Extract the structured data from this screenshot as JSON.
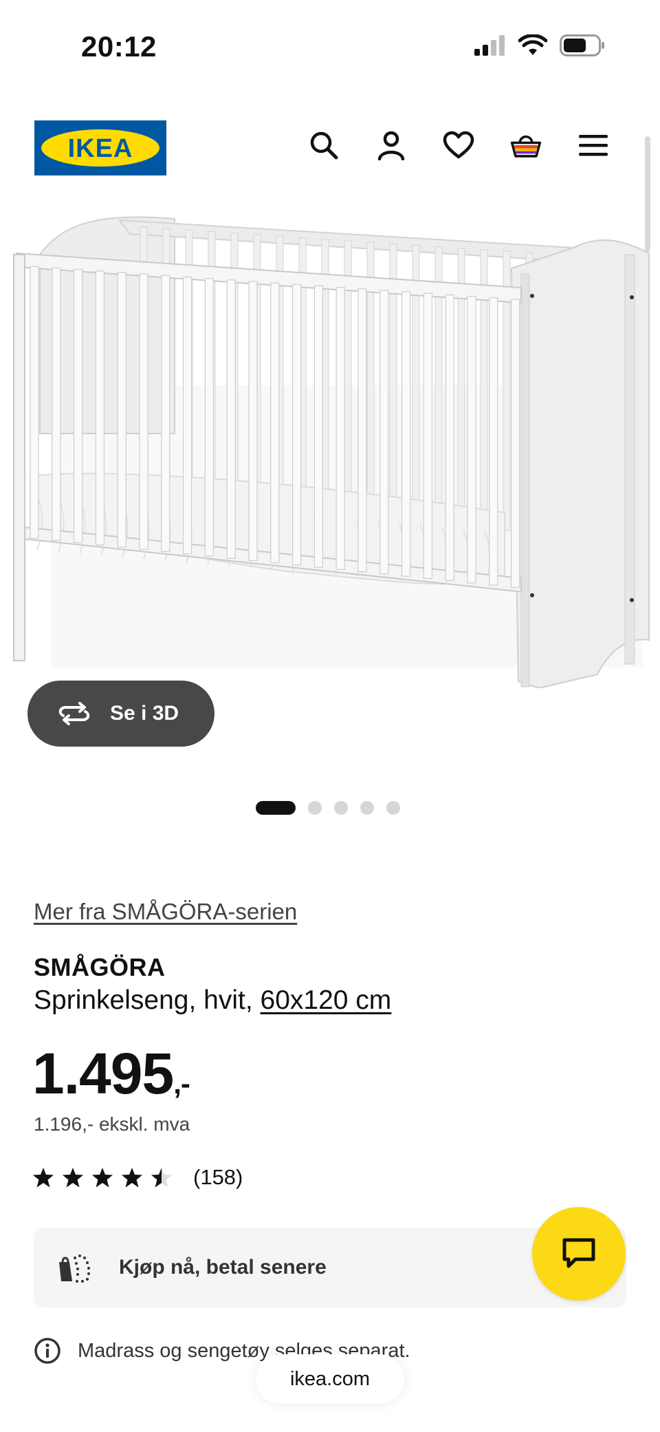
{
  "status_bar": {
    "time": "20:12",
    "icons": [
      "signal-icon",
      "wifi-icon",
      "battery-icon"
    ]
  },
  "header": {
    "logo_text": "IKEA",
    "icons": [
      "search-icon",
      "account-icon",
      "heart-icon",
      "cart-icon",
      "menu-icon"
    ],
    "colors": {
      "logo_blue": "#0058a3",
      "logo_yellow": "#ffdb00"
    }
  },
  "gallery": {
    "view_3d_label": "Se i 3D",
    "dot_count": 5,
    "active_dot": 1
  },
  "product": {
    "series_link": "Mer fra SMÅGÖRA-serien",
    "name": "SMÅGÖRA",
    "description_prefix": "Sprinkelseng, hvit,",
    "size_link": "60x120 cm",
    "price": "1.495",
    "price_suffix": ",-",
    "price_ex_vat": "1.196,- ekskl. mva",
    "rating": 4.5,
    "review_count": "(158)"
  },
  "bnpl": {
    "label": "Kjøp nå, betal senere"
  },
  "notice": {
    "text": "Madrass og sengetøy selges separat."
  },
  "browser": {
    "url": "ikea.com"
  },
  "chat": {
    "color": "#fbd914"
  }
}
